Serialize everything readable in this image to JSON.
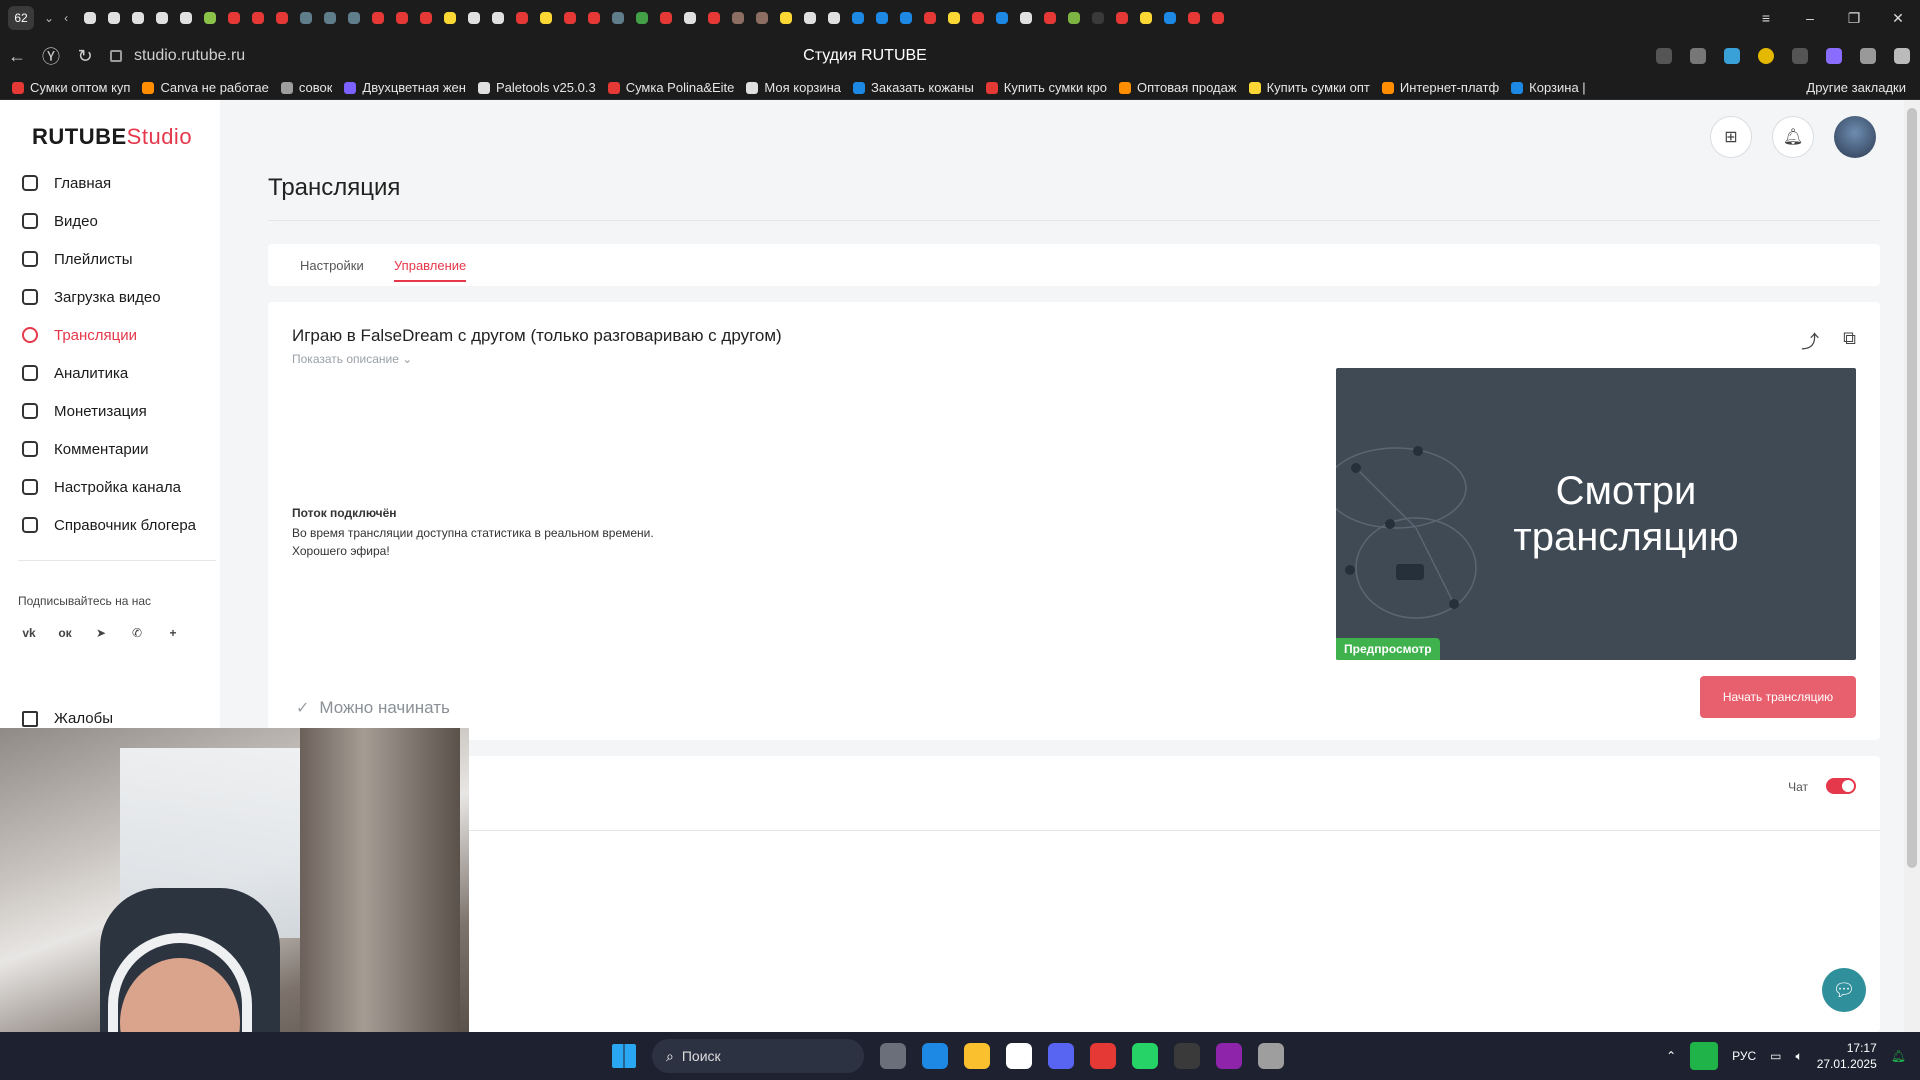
{
  "browser": {
    "tab_count": "62",
    "url": "studio.rutube.ru",
    "page_title": "Студия RUTUBE",
    "bookmarks": [
      {
        "label": "Сумки оптом куп",
        "color": "#e53935"
      },
      {
        "label": "Canva не работае",
        "color": "#ff8f00"
      },
      {
        "label": "совок",
        "color": "#9e9e9e"
      },
      {
        "label": "Двухцветная жен",
        "color": "#7b61ff"
      },
      {
        "label": "Paletools v25.0.3",
        "color": "#e0e0e0"
      },
      {
        "label": "Сумка Polina&Eite",
        "color": "#e53935"
      },
      {
        "label": "Моя корзина",
        "color": "#e0e0e0"
      },
      {
        "label": "Заказать кожаны",
        "color": "#1e88e5"
      },
      {
        "label": "Купить сумки кро",
        "color": "#e53935"
      },
      {
        "label": "Оптовая продаж",
        "color": "#ff8f00"
      },
      {
        "label": "Купить сумки опт",
        "color": "#fdd835"
      },
      {
        "label": "Интернет-платф",
        "color": "#ff8f00"
      },
      {
        "label": "Корзина |",
        "color": "#1e88e5"
      }
    ],
    "bookmarks_other": "Другие закладки"
  },
  "sidebar": {
    "logo_main": "RUTUBE",
    "logo_studio": "Studio",
    "items": [
      {
        "label": "Главная",
        "active": false
      },
      {
        "label": "Видео",
        "active": false
      },
      {
        "label": "Плейлисты",
        "active": false
      },
      {
        "label": "Загрузка видео",
        "active": false
      },
      {
        "label": "Трансляции",
        "active": true
      },
      {
        "label": "Аналитика",
        "active": false
      },
      {
        "label": "Монетизация",
        "active": false
      },
      {
        "label": "Комментарии",
        "active": false
      },
      {
        "label": "Настройка канала",
        "active": false
      },
      {
        "label": "Справочник блогера",
        "active": false
      }
    ],
    "subscribe_label": "Подписывайтесь на нас",
    "social": [
      "vk",
      "ok",
      "telegram",
      "viber",
      "more"
    ],
    "social_glyphs": {
      "vk": "vk",
      "ok": "ок",
      "telegram": "➤",
      "viber": "✆",
      "more": "+"
    },
    "complaints_label": "Жалобы"
  },
  "main": {
    "title": "Трансляция",
    "tabs": [
      {
        "label": "Настройки",
        "active": false
      },
      {
        "label": "Управление",
        "active": true
      }
    ],
    "stream_title": "Играю в FalseDream с другом (только разговариваю с другом)",
    "show_description": "Показать описание",
    "status_heading": "Поток подключён",
    "status_line1": "Во время трансляции доступна статистика в реальном времени.",
    "status_line2": "Хорошего эфира!",
    "preview_text_line1": "Смотри",
    "preview_text_line2": "трансляцию",
    "preview_badge": "Предпросмотр",
    "ready_label": "Можно начинать",
    "start_button": "Начать трансляцию",
    "chat_label": "Чат",
    "chat_enabled": true
  },
  "taskbar": {
    "search_placeholder": "Поиск",
    "language": "РУС",
    "time": "17:17",
    "date": "27.01.2025",
    "apps": [
      {
        "name": "task-view",
        "color": "#6b6f7a"
      },
      {
        "name": "edge",
        "color": "#1e88e5"
      },
      {
        "name": "explorer",
        "color": "#fbc02d"
      },
      {
        "name": "store",
        "color": "#ffffff"
      },
      {
        "name": "discord",
        "color": "#5865f2"
      },
      {
        "name": "yandex-browser",
        "color": "#e53935"
      },
      {
        "name": "whatsapp",
        "color": "#25d366"
      },
      {
        "name": "obs",
        "color": "#3a3a3a"
      },
      {
        "name": "winrar",
        "color": "#8e24aa"
      },
      {
        "name": "app",
        "color": "#9e9e9e"
      }
    ]
  }
}
